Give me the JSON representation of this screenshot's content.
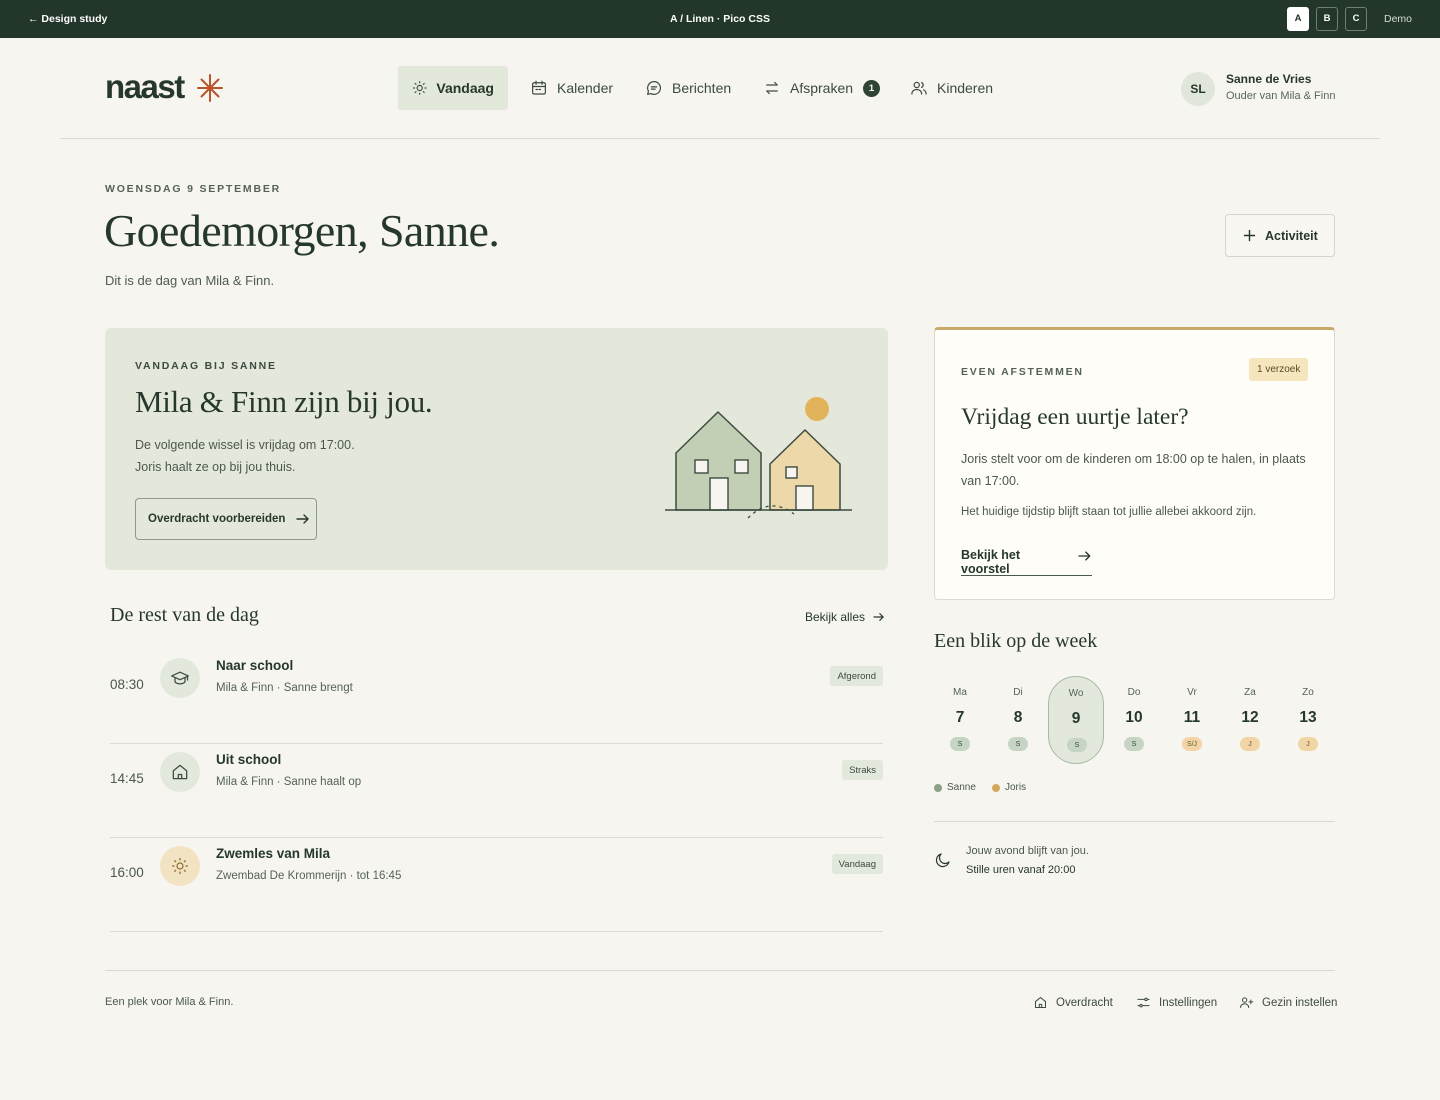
{
  "demobar": {
    "back": "← Design study",
    "variant": "A / Linen · Pico CSS",
    "variants": [
      "A",
      "B",
      "C"
    ],
    "mode": "Demo"
  },
  "brand": {
    "name": "naast",
    "mark_icon": "asterisk-icon",
    "mark_color": "#b8532a"
  },
  "nav": {
    "items": [
      {
        "label": "Vandaag",
        "icon": "sun-icon",
        "active": true
      },
      {
        "label": "Kalender",
        "icon": "calendar-icon"
      },
      {
        "label": "Berichten",
        "icon": "chat-icon"
      },
      {
        "label": "Afspraken",
        "icon": "swap-icon",
        "badge": "1"
      },
      {
        "label": "Kinderen",
        "icon": "users-icon"
      }
    ]
  },
  "user": {
    "initials": "SL",
    "name": "Sanne de Vries",
    "role": "Ouder van Mila & Finn"
  },
  "greeting": {
    "date": "WOENSDAG 9 SEPTEMBER",
    "title": "Goedemorgen, Sanne.",
    "subtitle": "Dit is de dag van Mila & Finn.",
    "action": "Activiteit"
  },
  "hero": {
    "eyebrow": "VANDAAG BIJ SANNE",
    "title": "Mila & Finn zijn bij jou.",
    "line1": "De volgende wissel is vrijdag om 17:00.",
    "line2": "Joris haalt ze op bij jou thuis.",
    "button": "Overdracht voorbereiden"
  },
  "request": {
    "eyebrow": "EVEN AFSTEMMEN",
    "pill": "1 verzoek",
    "title": "Vrijdag een uurtje later?",
    "body": "Joris stelt voor om de kinderen om 18:00 op te halen, in plaats van 17:00.",
    "note": "Het huidige tijdstip blijft staan tot jullie allebei akkoord zijn.",
    "link": "Bekijk het voorstel"
  },
  "day": {
    "title": "De rest van de dag",
    "see_all": "Bekijk alles",
    "items": [
      {
        "time": "08:30",
        "icon": "graduation-cap-icon",
        "title": "Naar school",
        "meta": "Mila & Finn · Sanne brengt",
        "status": "Afgerond"
      },
      {
        "time": "14:45",
        "icon": "home-icon",
        "title": "Uit school",
        "meta": "Mila & Finn · Sanne haalt op",
        "status": "Straks"
      },
      {
        "time": "16:00",
        "icon": "sun-icon",
        "title": "Zwemles van Mila",
        "meta": "Zwembad De Krommerijn · tot 16:45",
        "status": "Vandaag"
      }
    ]
  },
  "week": {
    "title": "Een blik op de week",
    "days": [
      {
        "name": "Ma",
        "date": "7",
        "who": "S",
        "parent": "s"
      },
      {
        "name": "Di",
        "date": "8",
        "who": "S",
        "parent": "s"
      },
      {
        "name": "Wo",
        "date": "9",
        "who": "S",
        "parent": "s",
        "today": true
      },
      {
        "name": "Do",
        "date": "10",
        "who": "S",
        "parent": "s"
      },
      {
        "name": "Vr",
        "date": "11",
        "who": "S/J",
        "parent": "j"
      },
      {
        "name": "Za",
        "date": "12",
        "who": "J",
        "parent": "j"
      },
      {
        "name": "Zo",
        "date": "13",
        "who": "J",
        "parent": "j"
      }
    ],
    "legend": [
      {
        "label": "Sanne",
        "color": "#8aa184"
      },
      {
        "label": "Joris",
        "color": "#d3a85c"
      }
    ],
    "night_line1": "Jouw avond blijft van jou.",
    "night_line2": "Stille uren vanaf 20:00"
  },
  "footer": {
    "text": "Een plek voor Mila & Finn.",
    "links": [
      {
        "label": "Overdracht",
        "icon": "home-icon"
      },
      {
        "label": "Instellingen",
        "icon": "sliders-icon"
      },
      {
        "label": "Gezin instellen",
        "icon": "user-plus-icon"
      }
    ]
  }
}
